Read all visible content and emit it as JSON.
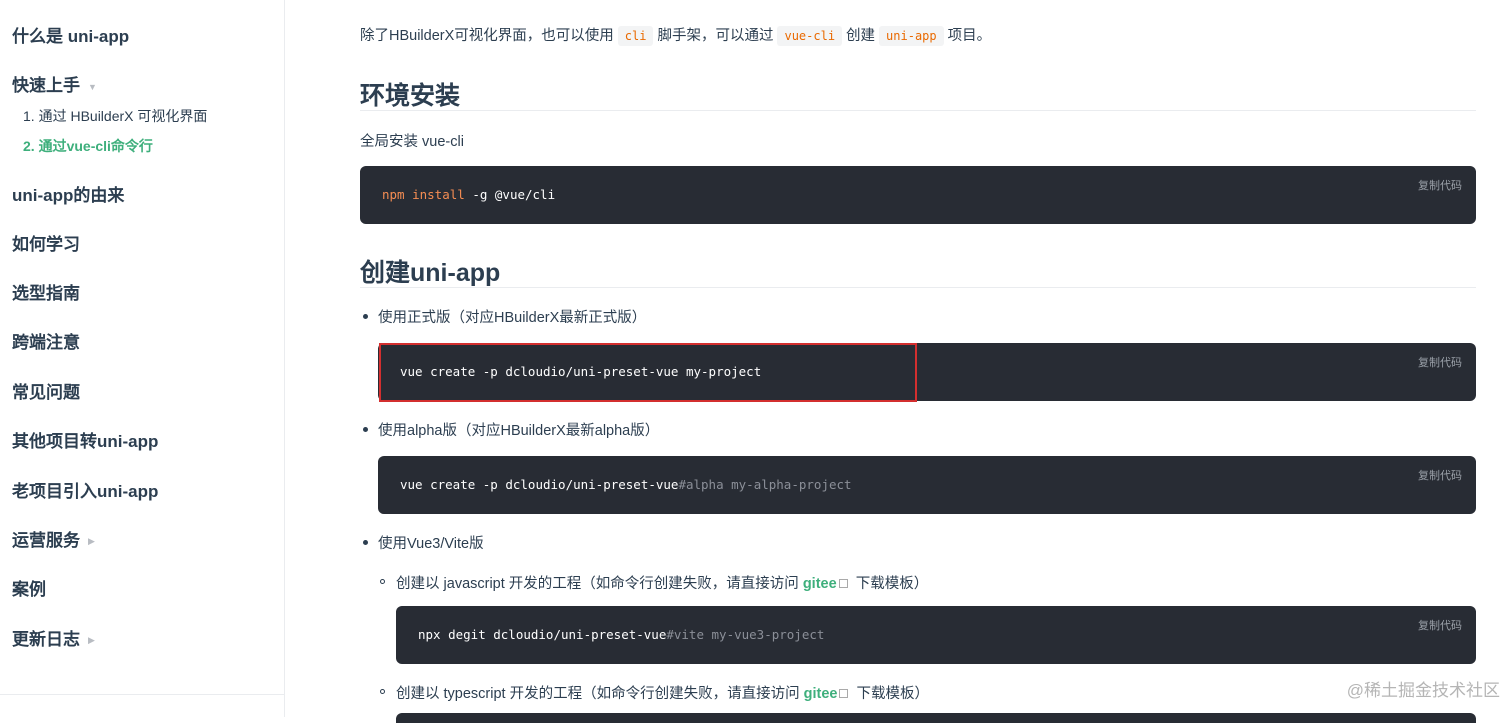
{
  "sidebar": {
    "items": [
      {
        "label": "什么是 uni-app"
      },
      {
        "label": "快速上手",
        "arrow": "▼"
      },
      {
        "label": "uni-app的由来"
      },
      {
        "label": "如何学习"
      },
      {
        "label": "选型指南"
      },
      {
        "label": "跨端注意"
      },
      {
        "label": "常见问题"
      },
      {
        "label": "其他项目转uni-app"
      },
      {
        "label": "老项目引入uni-app"
      },
      {
        "label": "运营服务",
        "arrow": "▶"
      },
      {
        "label": "案例"
      },
      {
        "label": "更新日志",
        "arrow": "▶"
      }
    ],
    "subitems": [
      {
        "label": "1. 通过 HBuilderX 可视化界面"
      },
      {
        "label": "2. 通过vue-cli命令行"
      }
    ]
  },
  "content": {
    "intro": {
      "t1": "除了HBuilderX可视化界面，也可以使用",
      "c1": "cli",
      "t2": "脚手架，可以通过",
      "c2": "vue-cli",
      "t3": "创建",
      "c3": "uni-app",
      "t4": "项目。"
    },
    "h_env": "环境安装",
    "env_desc": "全局安装 vue-cli",
    "copy_label": "复制代码",
    "code1": {
      "a": "npm",
      "b": "install",
      "c": "-g @vue/cli"
    },
    "h_create": "创建uni-app",
    "bullet1": "使用正式版（对应HBuilderX最新正式版）",
    "code2": "vue create -p dcloudio/uni-preset-vue my-project",
    "bullet2": "使用alpha版（对应HBuilderX最新alpha版）",
    "code3": {
      "a": "vue create -p dcloudio/uni-preset-vue",
      "b": "#alpha my-alpha-project"
    },
    "bullet3": "使用Vue3/Vite版",
    "sub1": {
      "pre": "创建以 javascript 开发的工程（如命令行创建失败，请直接访问 ",
      "link": "gitee",
      "post": " 下载模板）"
    },
    "code4": {
      "a": "npx degit dcloudio/uni-preset-vue",
      "b": "#vite my-vue3-project"
    },
    "sub2": {
      "pre": "创建以 typescript 开发的工程（如命令行创建失败，请直接访问 ",
      "link": "gitee",
      "post": " 下载模板）"
    }
  },
  "watermark": "@稀土掘金技术社区"
}
